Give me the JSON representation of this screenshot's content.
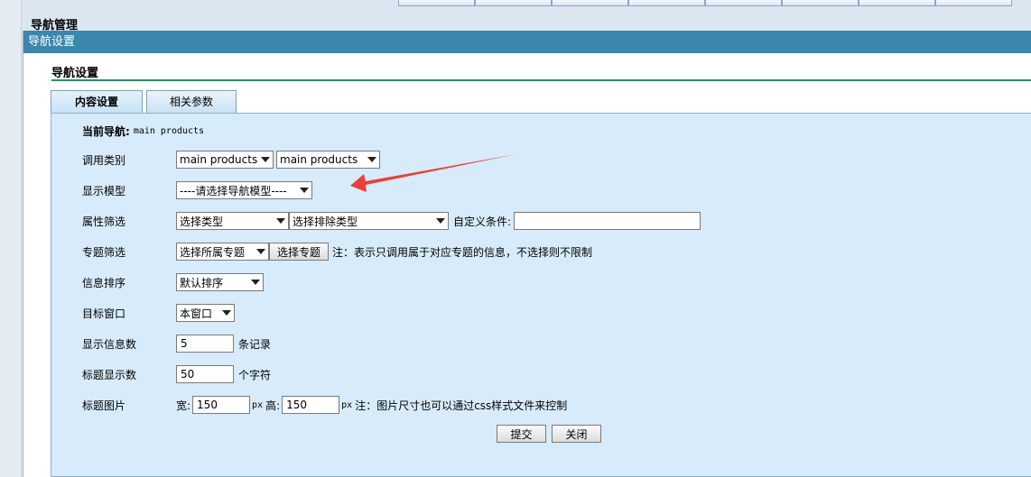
{
  "outer_title": "导航管理",
  "panel_header": "导航设置",
  "section_title": "导航设置",
  "tabs": [
    {
      "label": "内容设置"
    },
    {
      "label": "相关参数"
    }
  ],
  "form": {
    "current_nav": {
      "label": "当前导航:",
      "value": "main products"
    },
    "call_type": {
      "label": "调用类别",
      "select1": "main products",
      "select2": "main products"
    },
    "display_model": {
      "label": "显示模型",
      "select": "----请选择导航模型----"
    },
    "attr_filter": {
      "label": "属性筛选",
      "select1": "选择类型",
      "select2": "选择排除类型",
      "custom_label": "自定义条件:",
      "custom_value": ""
    },
    "topic_filter": {
      "label": "专题筛选",
      "select": "选择所属专题",
      "button": "选择专题",
      "note": "注：表示只调用属于对应专题的信息，不选择则不限制"
    },
    "sort": {
      "label": "信息排序",
      "select": "默认排序"
    },
    "target": {
      "label": "目标窗口",
      "select": "本窗口"
    },
    "count": {
      "label": "显示信息数",
      "value": "5",
      "unit": "条记录"
    },
    "title_len": {
      "label": "标题显示数",
      "value": "50",
      "unit": "个字符"
    },
    "title_img": {
      "label": "标题图片",
      "width_label": "宽:",
      "width_value": "150",
      "px1": "px",
      "height_label": "高:",
      "height_value": "150",
      "px2": "px",
      "note": "注：图片尺寸也可以通过css样式文件来控制"
    },
    "submit": "提交",
    "close": "关闭"
  },
  "colors": {
    "header": "#3c86ac",
    "form_bg": "#d7ebfa",
    "rule": "#2e8a66",
    "arrow": "#e8413a"
  }
}
